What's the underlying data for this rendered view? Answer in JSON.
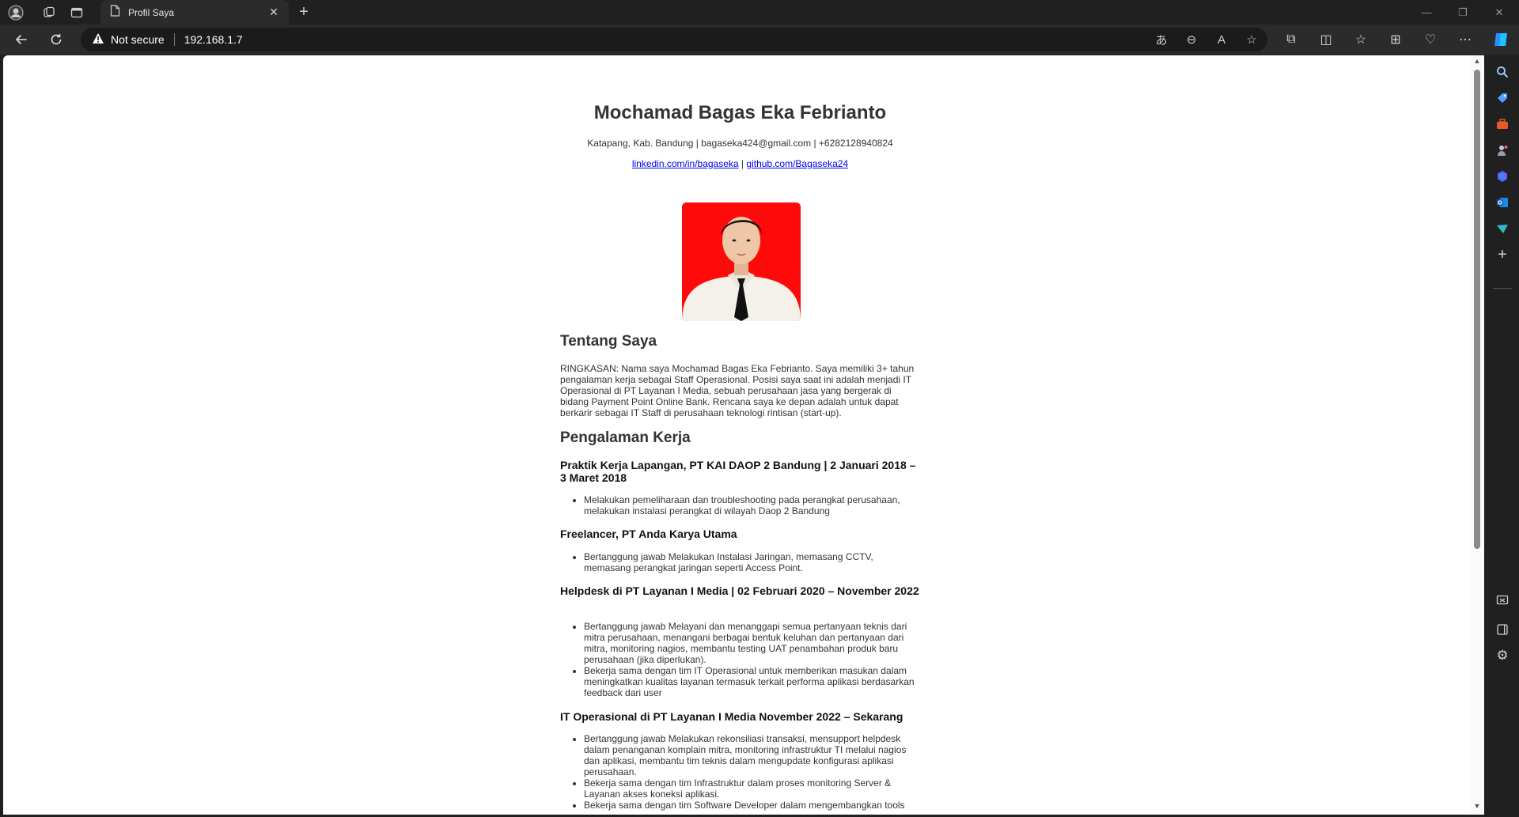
{
  "browser": {
    "tab_title": "Profil Saya",
    "security_label": "Not secure",
    "url": "192.168.1.7"
  },
  "cv": {
    "name": "Mochamad Bagas Eka Febrianto",
    "contact": "Katapang, Kab. Bandung | bagaseka424@gmail.com | +6282128940824",
    "linkedin": "linkedin.com/in/bagaseka",
    "link_separator": "|",
    "github": "github.com/Bagaseka24",
    "about_heading": "Tentang Saya",
    "about_text": "RINGKASAN: Nama saya Mochamad Bagas Eka Febrianto. Saya memiliki 3+ tahun pengalaman kerja sebagai Staff Operasional. Posisi saya saat ini adalah menjadi IT Operasional di PT Layanan I Media, sebuah perusahaan jasa yang bergerak di bidang Payment Point Online Bank. Rencana saya ke depan adalah untuk dapat berkarir sebagai IT Staff di perusahaan teknologi rintisan (start-up).",
    "experience_heading": "Pengalaman Kerja",
    "jobs": [
      {
        "title": "Praktik Kerja Lapangan, PT KAI DAOP 2 Bandung | 2 Januari 2018 – 3 Maret 2018",
        "items": [
          "Melakukan pemeliharaan dan troubleshooting pada perangkat perusahaan, melakukan instalasi perangkat di wilayah Daop 2 Bandung"
        ]
      },
      {
        "title": "Freelancer, PT Anda Karya Utama",
        "items": [
          "Bertanggung jawab Melakukan Instalasi Jaringan, memasang CCTV, memasang perangkat jaringan seperti Access Point."
        ]
      },
      {
        "title": "Helpdesk di PT Layanan I Media | 02 Februari 2020 – November 2022",
        "items": [
          "Bertanggung jawab Melayani dan menanggapi semua pertanyaan teknis dari mitra perusahaan, menangani berbagai bentuk keluhan dan pertanyaan dari mitra, monitoring nagios, membantu testing UAT penambahan produk baru perusahaan (jika diperlukan).",
          "Bekerja sama dengan tim IT Operasional untuk memberikan masukan dalam meningkatkan kualitas layanan termasuk terkait performa aplikasi berdasarkan feedback dari user"
        ]
      },
      {
        "title": "IT Operasional di PT Layanan I Media November 2022 – Sekarang",
        "items": [
          "Bertanggung jawab Melakukan rekonsiliasi transaksi, mensupport helpdesk dalam penanganan komplain mitra, monitoring infrastruktur TI melalui nagios dan aplikasi, membantu tim teknis dalam mengupdate konfigurasi aplikasi perusahaan.",
          "Bekerja sama dengan tim Infrastruktur dalam proses monitoring Server & Layanan akses koneksi aplikasi.",
          "Bekerja sama dengan tim Software Developer dalam mengembangkan tools"
        ]
      }
    ]
  }
}
